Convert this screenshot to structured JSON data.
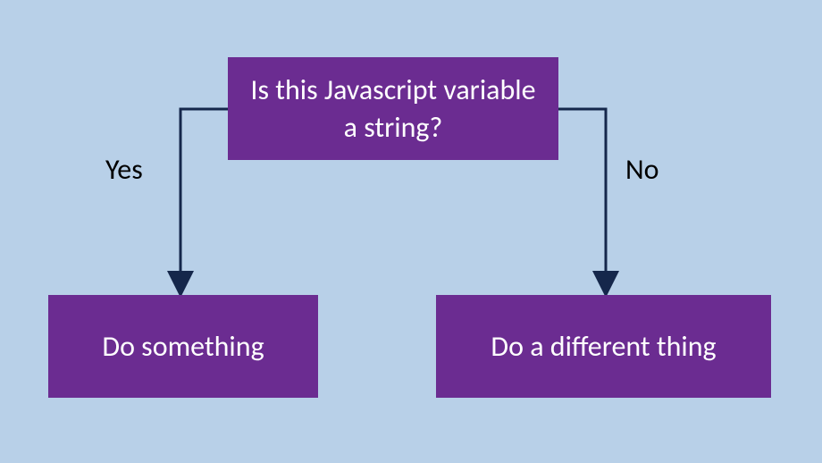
{
  "diagram": {
    "decision": "Is this Javascript variable a string?",
    "yes_label": "Yes",
    "no_label": "No",
    "yes_action": "Do something",
    "no_action": "Do a different thing"
  },
  "colors": {
    "background": "#b8d0e8",
    "box_fill": "#6b2c91",
    "box_text": "#ffffff",
    "arrow": "#15274b",
    "label_text": "#000000"
  }
}
